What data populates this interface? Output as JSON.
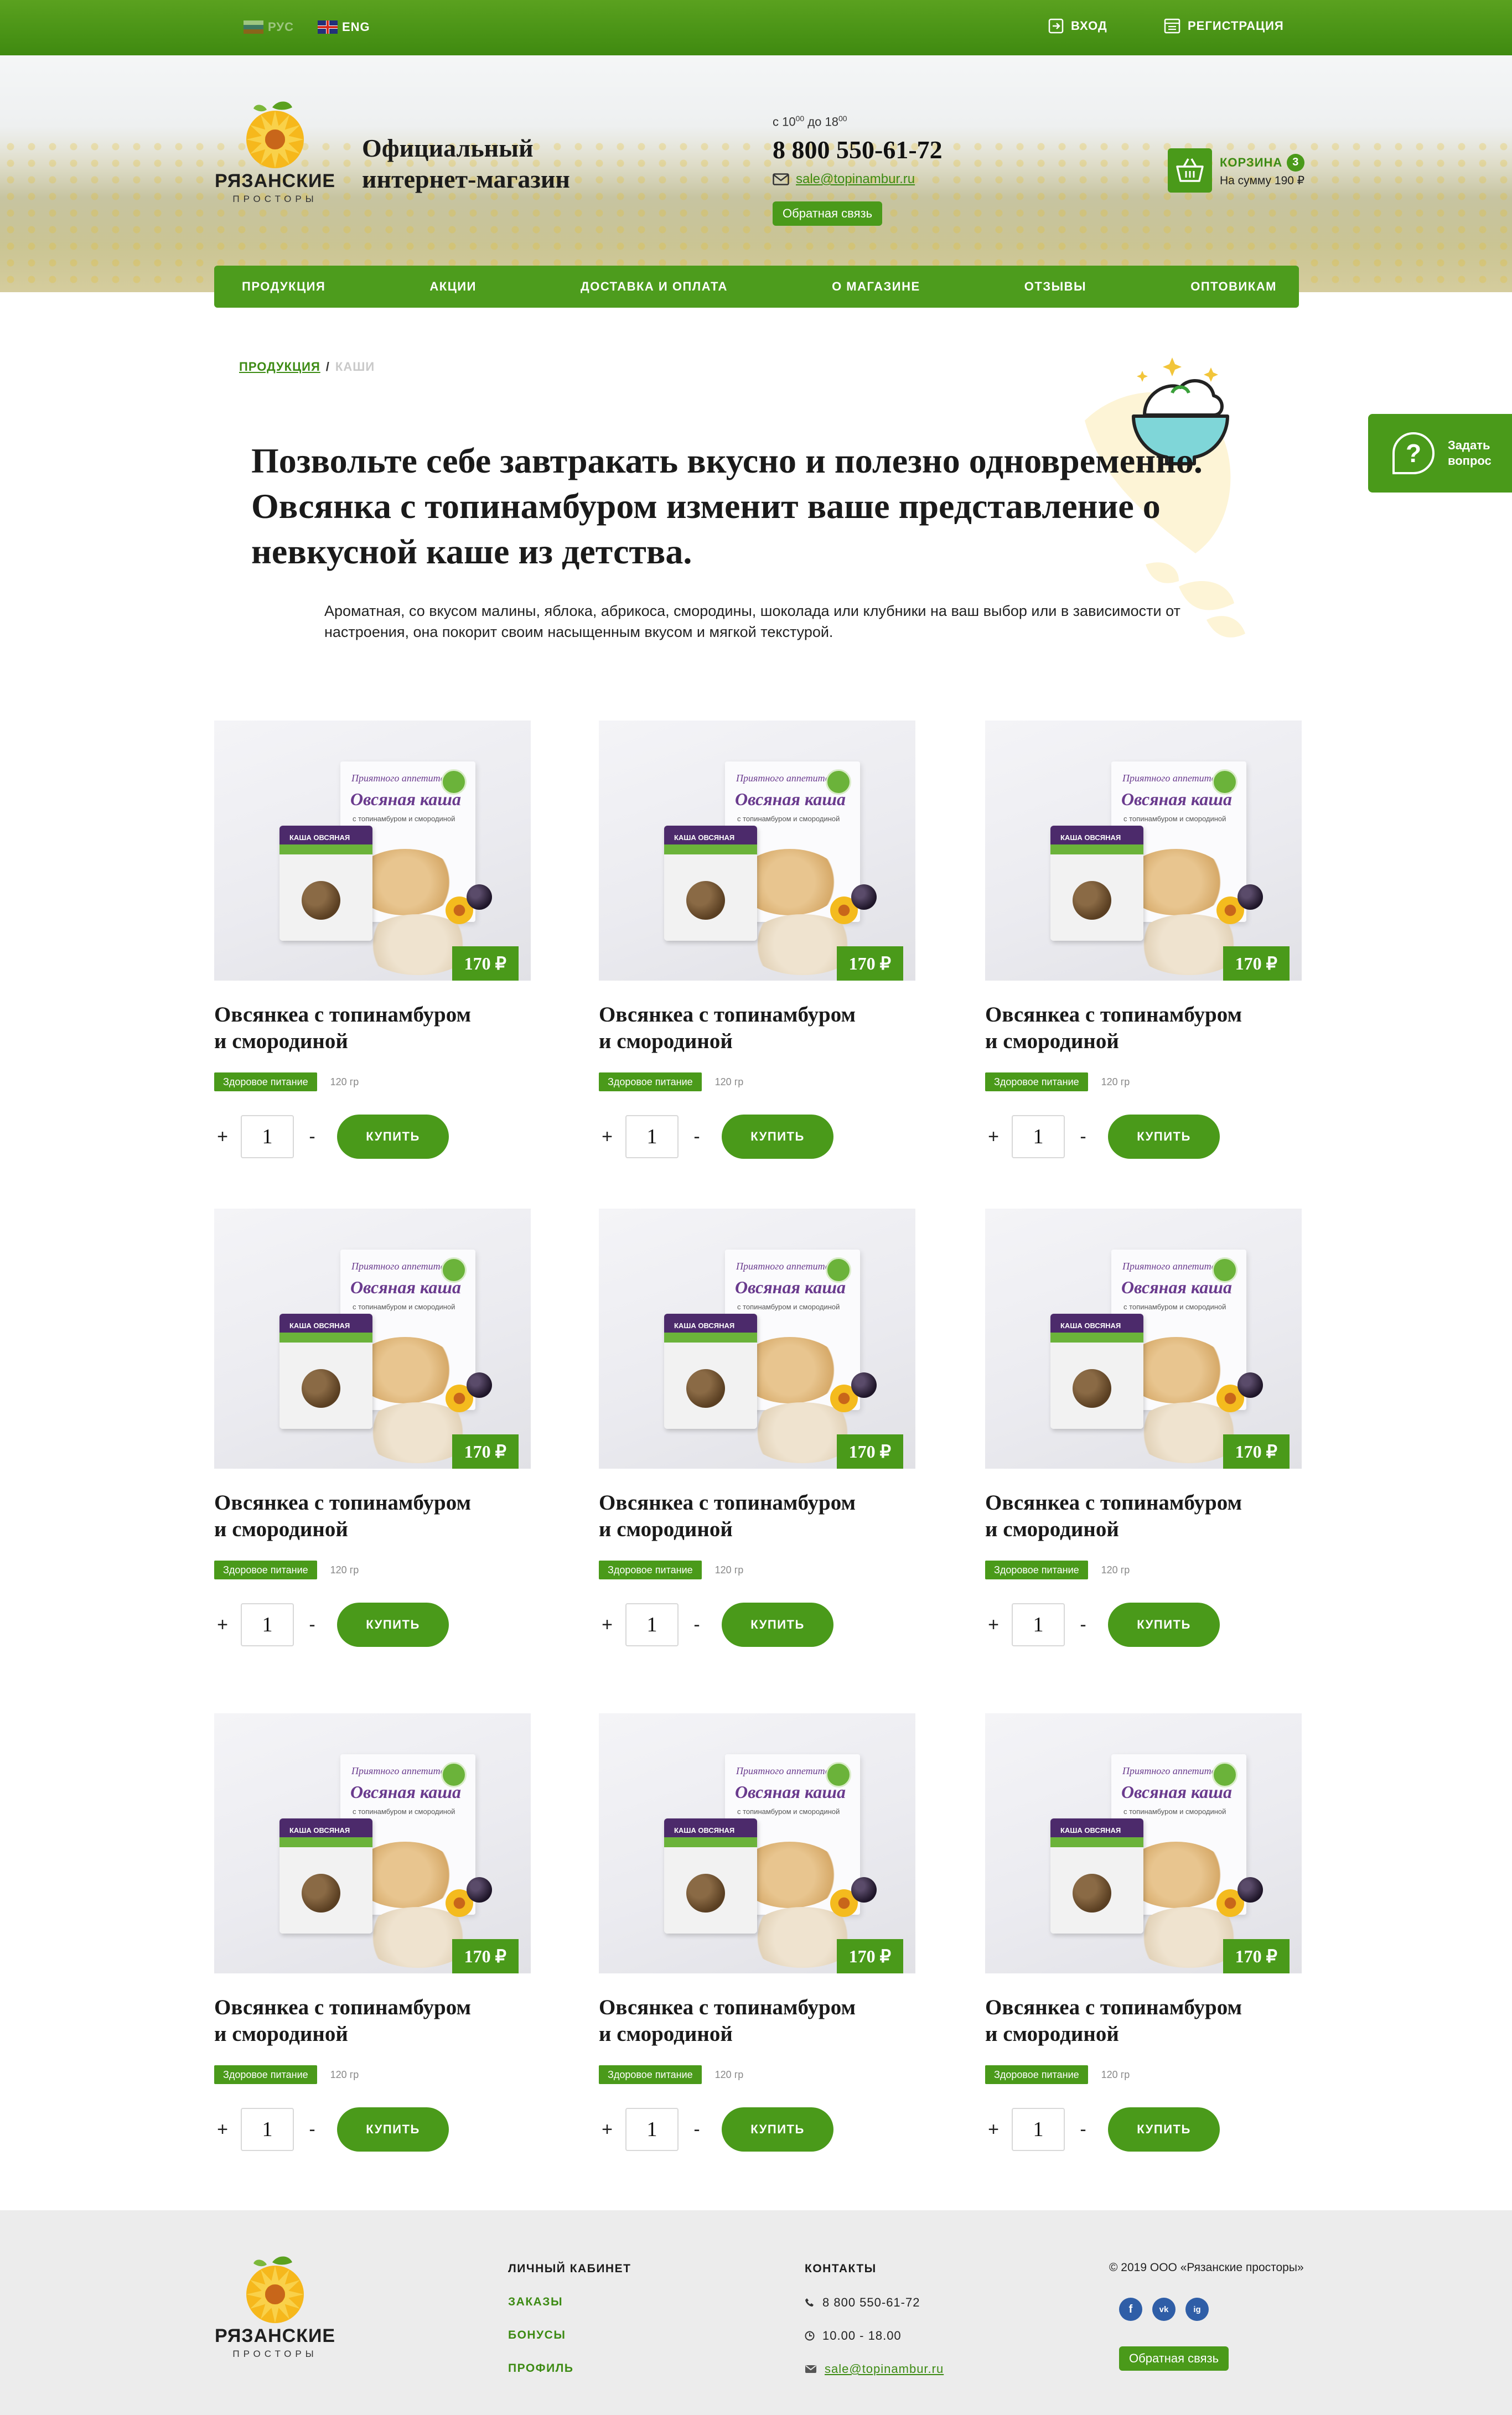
{
  "topbar": {
    "lang_ru": "РУС",
    "lang_en": "ENG",
    "login": "ВХОД",
    "register": "РЕГИСТРАЦИЯ"
  },
  "header": {
    "logo_name": "РЯЗАНСКИЕ",
    "logo_sub": "ПРОСТОРЫ",
    "slogan_line1": "Официальный",
    "slogan_line2": "интернет-магазин",
    "hours_prefix": "с 10",
    "hours_from_min": "00",
    "hours_mid": " до 18",
    "hours_to_min": "00",
    "phone": "8 800 550-61-72",
    "email": "sale@topinambur.ru",
    "feedback": "Обратная связь",
    "cart_label": "КОРЗИНА",
    "cart_count": "3",
    "cart_sum": "На сумму 190 ₽"
  },
  "nav": [
    "ПРОДУКЦИЯ",
    "АКЦИИ",
    "ДОСТАВКА И ОПЛАТА",
    "О МАГАЗИНЕ",
    "ОТЗЫВЫ",
    "ОПТОВИКАМ"
  ],
  "breadcrumb": {
    "link": "ПРОДУКЦИЯ",
    "sep": "/",
    "current": "КАШИ"
  },
  "intro": {
    "title": "Позвольте себе завтракать вкусно и полезно одновременно. Овсянка с топинамбуром изменит ваше представление о невкусной каше из детства.",
    "text": "Ароматная, со вкусом малины, яблока, абрикоса, смородины, шоколада или клубники на ваш выбор или в зависимости от настроения, она покорит своим насыщенным вкусом и мягкой текстурой."
  },
  "ask": {
    "icon_glyph": "?",
    "label_line1": "Задать",
    "label_line2": "вопрос"
  },
  "product_image": {
    "box_script": "Приятного аппетита",
    "box_title": "Овсяная каша",
    "box_sub": "с топинамбуром и смородиной",
    "bag_text": "КАША ОВСЯНАЯ"
  },
  "products": [
    {
      "name_line1": "Овсянкеа с топинамбуром",
      "name_line2": "и смородиной",
      "price": "170 ₽",
      "tag": "Здоровое питание",
      "weight": "120 гр",
      "qty": "1",
      "buy": "КУПИТЬ"
    },
    {
      "name_line1": "Овсянкеа с топинамбуром",
      "name_line2": "и смородиной",
      "price": "170 ₽",
      "tag": "Здоровое питание",
      "weight": "120 гр",
      "qty": "1",
      "buy": "КУПИТЬ"
    },
    {
      "name_line1": "Овсянкеа с топинамбуром",
      "name_line2": "и смородиной",
      "price": "170 ₽",
      "tag": "Здоровое питание",
      "weight": "120 гр",
      "qty": "1",
      "buy": "КУПИТЬ"
    },
    {
      "name_line1": "Овсянкеа с топинамбуром",
      "name_line2": "и смородиной",
      "price": "170 ₽",
      "tag": "Здоровое питание",
      "weight": "120 гр",
      "qty": "1",
      "buy": "КУПИТЬ"
    },
    {
      "name_line1": "Овсянкеа с топинамбуром",
      "name_line2": "и смородиной",
      "price": "170 ₽",
      "tag": "Здоровое питание",
      "weight": "120 гр",
      "qty": "1",
      "buy": "КУПИТЬ"
    },
    {
      "name_line1": "Овсянкеа с топинамбуром",
      "name_line2": "и смородиной",
      "price": "170 ₽",
      "tag": "Здоровое питание",
      "weight": "120 гр",
      "qty": "1",
      "buy": "КУПИТЬ"
    },
    {
      "name_line1": "Овсянкеа с топинамбуром",
      "name_line2": "и смородиной",
      "price": "170 ₽",
      "tag": "Здоровое питание",
      "weight": "120 гр",
      "qty": "1",
      "buy": "КУПИТЬ"
    },
    {
      "name_line1": "Овсянкеа с топинамбуром",
      "name_line2": "и смородиной",
      "price": "170 ₽",
      "tag": "Здоровое питание",
      "weight": "120 гр",
      "qty": "1",
      "buy": "КУПИТЬ"
    },
    {
      "name_line1": "Овсянкеа с топинамбуром",
      "name_line2": "и смородиной",
      "price": "170 ₽",
      "tag": "Здоровое питание",
      "weight": "120 гр",
      "qty": "1",
      "buy": "КУПИТЬ"
    }
  ],
  "qty_controls": {
    "plus": "+",
    "minus": "-"
  },
  "footer": {
    "account_title": "ЛИЧНЫЙ КАБИНЕТ",
    "account_links": [
      "ЗАКАЗЫ",
      "БОНУСЫ",
      "ПРОФИЛЬ"
    ],
    "contacts_title": "КОНТАКТЫ",
    "phone": "8 800 550-61-72",
    "hours": "10.00 - 18.00",
    "email": "sale@topinambur.ru",
    "copyright": "© 2019 ООО «Рязанские просторы»",
    "feedback": "Обратная связь",
    "social": [
      "f",
      "vk",
      "ig"
    ]
  },
  "colors": {
    "brand_green": "#4a9a1a",
    "link_green": "#3d8b14",
    "footer_bg": "#ececec"
  }
}
